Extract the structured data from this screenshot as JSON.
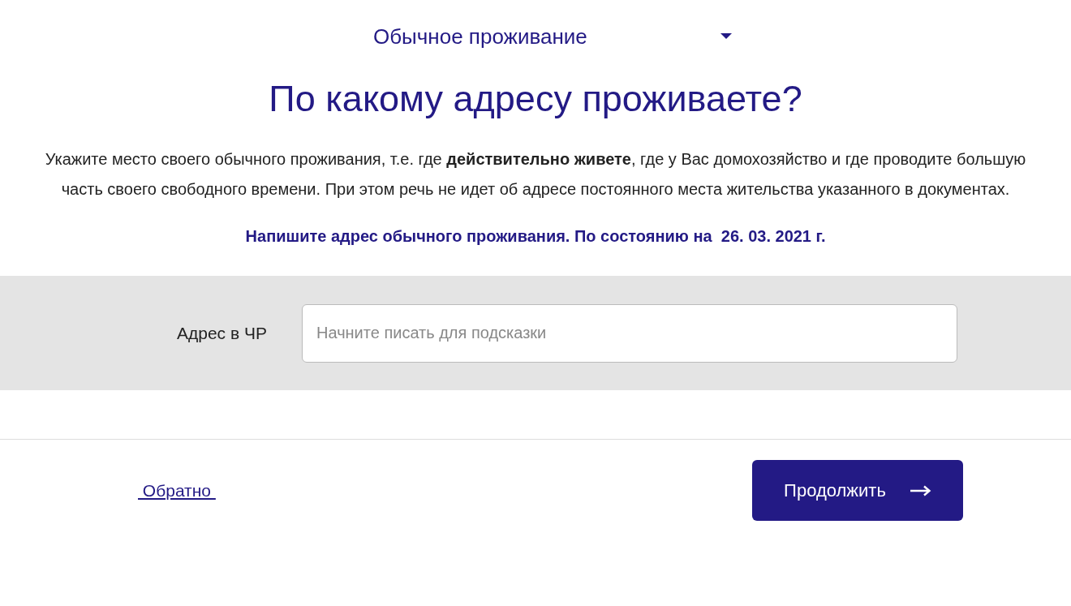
{
  "residence_select": {
    "value": "Обычное проживание"
  },
  "heading": "По какому адресу проживаете?",
  "description": "Укажите место своего обычного проживания, т.е. где **действительно живете**, где у Вас домохозяйство и где проводите большую часть своего свободного времени. При этом речь не идет об адресе постоянного места жительства указанного в документах.",
  "instruction": "Напишите адрес обычного проживания. По состоянию на  26. 03. 2021 г.",
  "address_field": {
    "label": "Адрес в ЧР",
    "placeholder": "Начните писать для подсказки"
  },
  "footer": {
    "back_link": " Обратно ",
    "continue_button": "Продолжить"
  }
}
